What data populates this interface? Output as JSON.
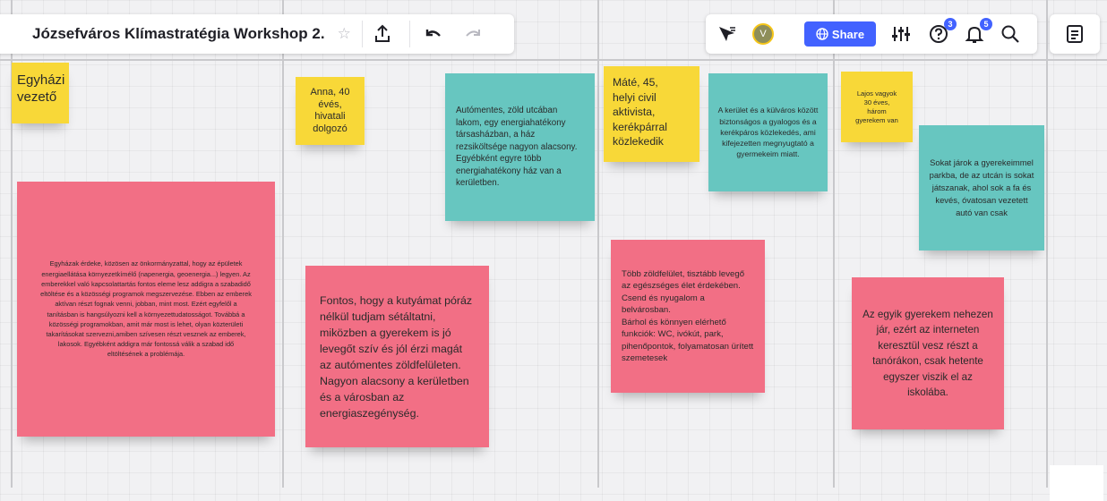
{
  "toolbar": {
    "board_title": "Józsefváros Klímastratégia Workshop 2.",
    "share_label": "Share",
    "avatar_initial": "V",
    "help_badge": "3",
    "notifications_badge": "5"
  },
  "icons": {
    "star": "☆",
    "export": "⇪",
    "undo": "↶",
    "redo": "↷"
  },
  "notes": {
    "church_leader": "Egyházi\nvezető",
    "anna": "Anna, 40\névés,\nhivatali\ndolgozó",
    "car_free": "Autómentes, zöld utcában lakom, egy energiahatékony társasházban, a ház rezsiköltsége nagyon alacsony. Egyébként egyre több energiahatékony ház van a kerületben.",
    "mate": "Máté, 45,\nhelyi civil\naktivista,\nkerékpárral\nközlekedik",
    "safe_transport": "A kerület és a külváros között biztonságos a gyalogos és a kerékpáros közlekedés, ami kifejezetten megnyugtató a gyermekeim miatt.",
    "lajos": "Lajos vagyok\n30 éves,\nhárom\ngyerekem van",
    "park": "Sokat járok a gyerekeimmel parkba, de az utcán is sokat játszanak, ahol sok a fa és kevés, óvatosan vezetett autó van csak",
    "churches": "Egyházak érdeke, közösen az önkormányzattal, hogy az épületek energiaellátása környezetkímélő (napenergia, geoenergia...) legyen. Az emberekkel való kapcsolattartás fontos eleme lesz addigra a szabadidő eltöltése és a közösségi programok megszervezése. Ebben az emberek aktívan részt fognak venni, jobban, mint most. Ezért egyfelől a tanításban is hangsúlyozni kell a környezettudatosságot. Továbbá a közösségi programokban, amit már most is lehet, olyan közterületi takarításokat szervezni,amiben szívesen részt vesznek az emberek, lakosok. Egyébként addigra már fontossá válik a szabad idő eltöltésének a problémája.",
    "dog": "Fontos, hogy a kutyámat póráz nélkül tudjam sétáltatni, miközben a gyerekem is jó levegőt szív és jól érzi magát az autómentes zöldfelületen. Nagyon alacsony a kerületben és a városban az energiaszegénység.",
    "greenery": "Több zöldfelület, tisztább levegő az egészséges élet érdekében.\nCsend és nyugalom a belvárosban.\nBárhol és könnyen elérhető funkciók: WC, ivókút, park, pihenőpontok, folyamatosan ürített szemetesek",
    "child_school": "Az egyik gyerekem nehezen jár, ezért az interneten keresztül vesz részt a tanórákon, csak hetente egyszer viszik el az iskolába."
  }
}
